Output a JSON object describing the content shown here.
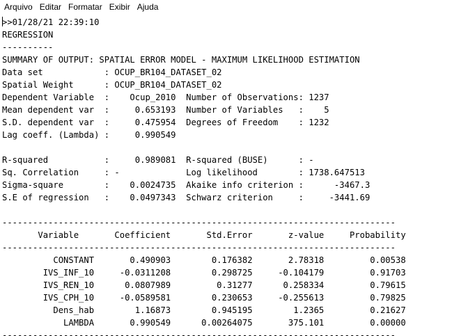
{
  "window": {
    "menu": [
      "Arquivo",
      "Editar",
      "Formatar",
      "Exibir",
      "Ajuda"
    ]
  },
  "document": {
    "lines": [
      ">>01/28/21 22:39:10",
      "REGRESSION",
      "----------",
      "SUMMARY OF OUTPUT: SPATIAL ERROR MODEL - MAXIMUM LIKELIHOOD ESTIMATION",
      "Data set            : OCUP_BR104_DATASET_02",
      "Spatial Weight      : OCUP_BR104_DATASET_02",
      "Dependent Variable  :    Ocup_2010  Number of Observations: 1237",
      "Mean dependent var  :     0.653193  Number of Variables   :    5",
      "S.D. dependent var  :     0.475954  Degrees of Freedom    : 1232",
      "Lag coeff. (Lambda) :     0.990549",
      "",
      "R-squared           :     0.989081  R-squared (BUSE)      : -",
      "Sq. Correlation     : -             Log likelihood        : 1738.647513",
      "Sigma-square        :    0.0024735  Akaike info criterion :      -3467.3",
      "S.E of regression   :    0.0497343  Schwarz criterion     :     -3441.69",
      "",
      "-----------------------------------------------------------------------------",
      "       Variable       Coefficient       Std.Error       z-value     Probability",
      "-----------------------------------------------------------------------------",
      "          CONSTANT       0.490903        0.176382       2.78318         0.00538",
      "        IVS_INF_10     -0.0311208        0.298725     -0.104179         0.91703",
      "        IVS_REN_10      0.0807989         0.31277      0.258334         0.79615",
      "        IVS_CPH_10     -0.0589581        0.230653     -0.255613         0.79825",
      "          Dens_hab        1.16873        0.945195        1.2365         0.21627",
      "            LAMBDA       0.990549      0.00264075       375.101         0.00000",
      "-----------------------------------------------------------------------------"
    ]
  }
}
